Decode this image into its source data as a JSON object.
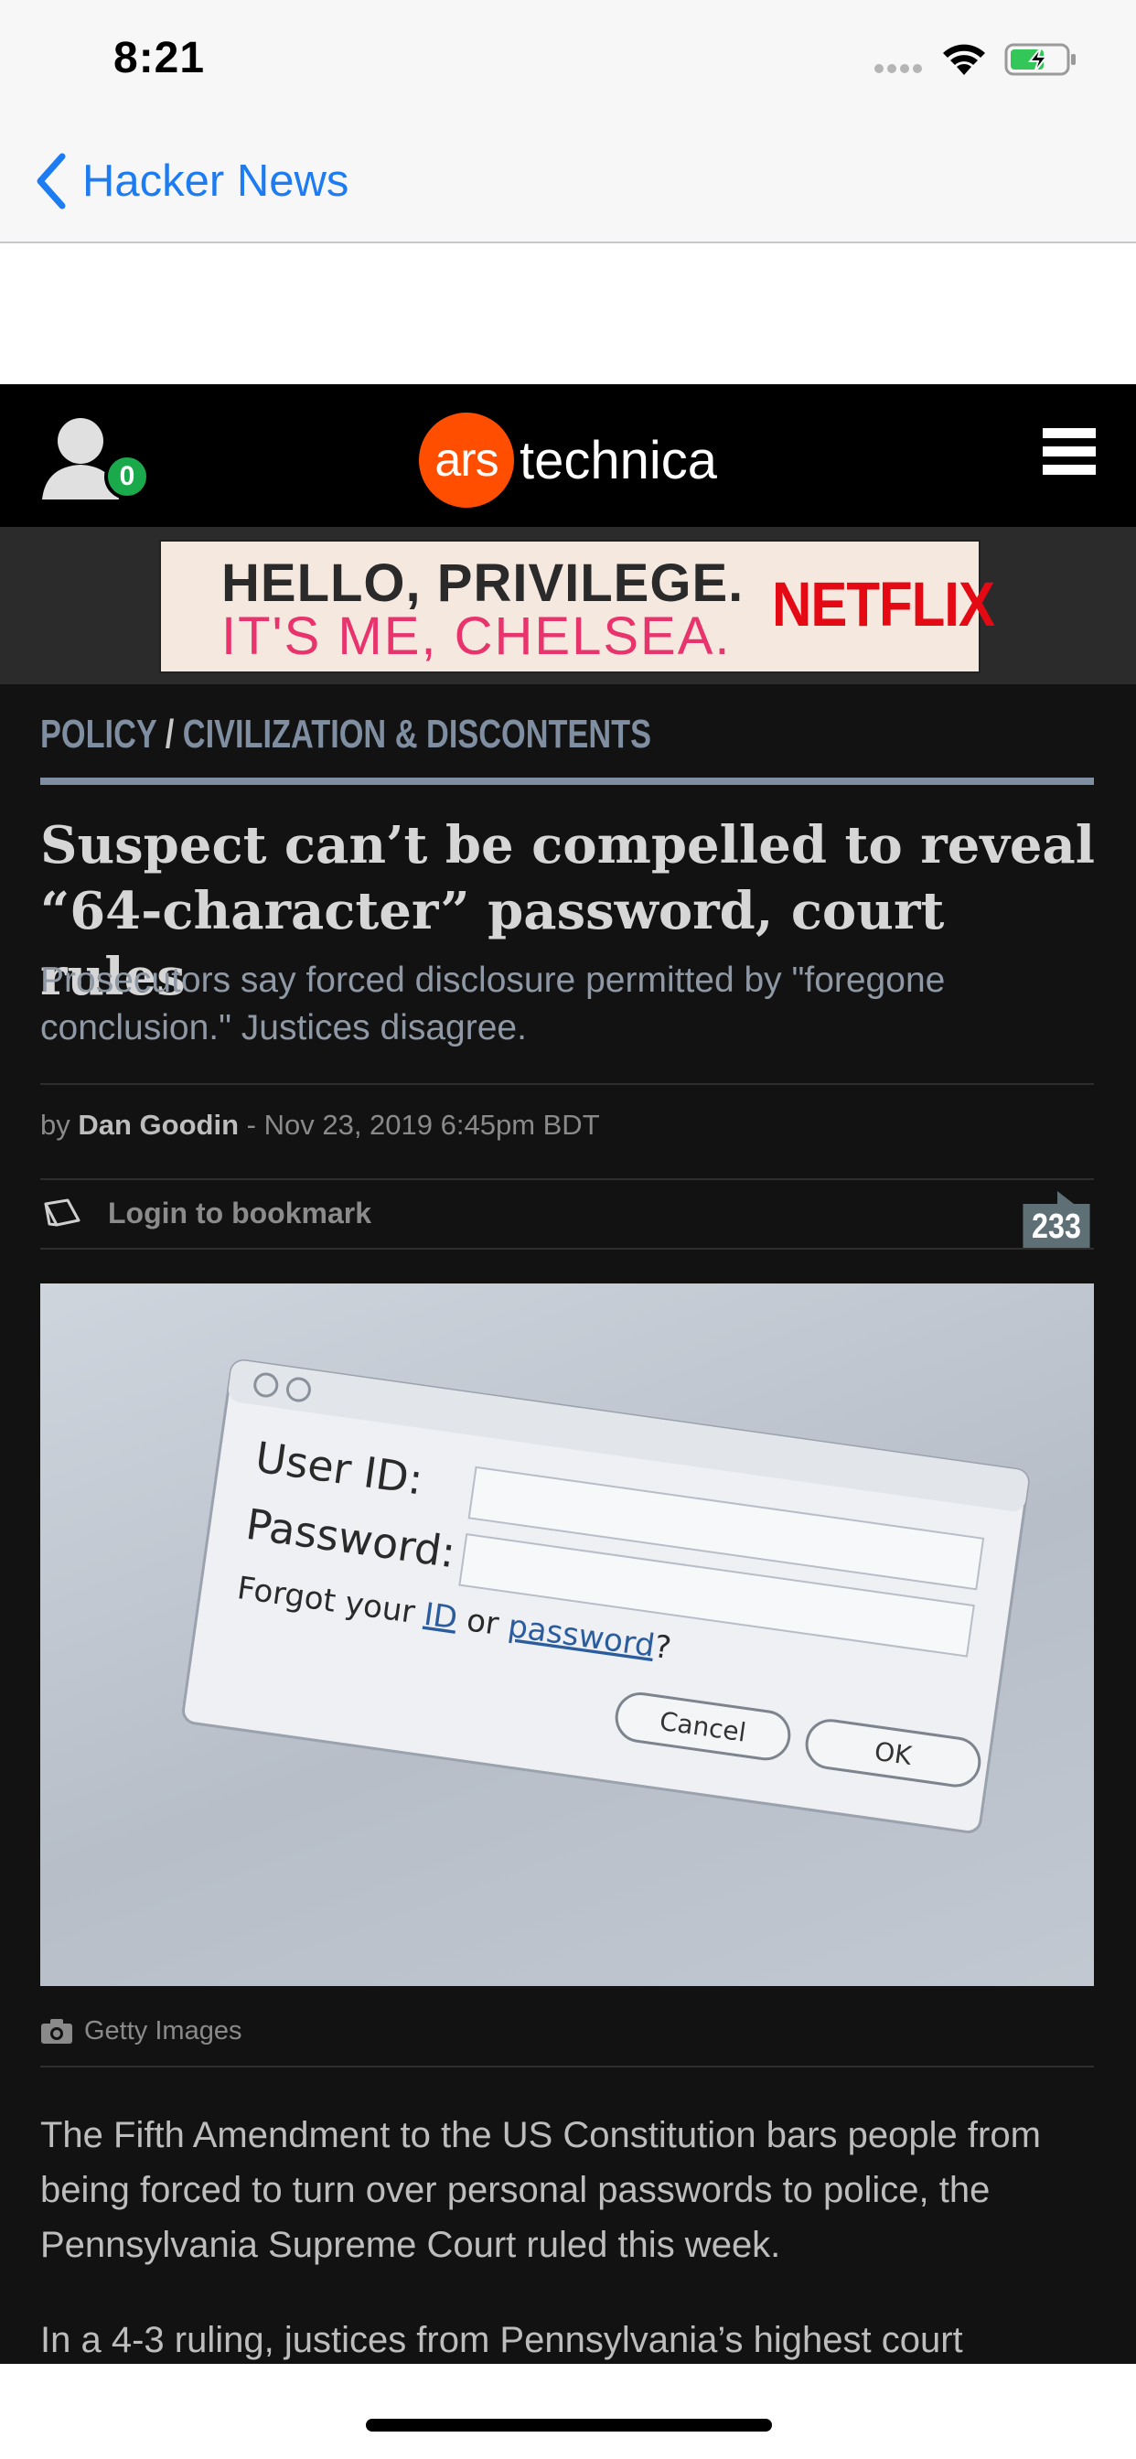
{
  "status_bar": {
    "time": "8:21"
  },
  "nav": {
    "back_label": "Hacker News"
  },
  "ars": {
    "notification_count": "0",
    "logo_circle": "ars",
    "logo_word": "technica"
  },
  "ad": {
    "line1": "HELLO, PRIVILEGE.",
    "line2": "IT'S ME, CHELSEA.",
    "brand": "NETFLIX"
  },
  "article": {
    "breadcrumb": [
      "POLICY",
      "/",
      "CIVILIZATION & DISCONTENTS"
    ],
    "headline": "Suspect can’t be compelled to reveal “64-character” password, court rules",
    "dek": "Prosecutors say forced disclosure permitted by \"foregone conclusion.\" Justices disagree.",
    "byline_prefix": "by",
    "author": "Dan Goodin",
    "date": "- Nov 23, 2019 6:45pm BDT",
    "bookmark_label": "Login to bookmark",
    "comment_count": "233",
    "hero_image": {
      "user_id_label": "User ID:",
      "password_label": "Password:",
      "forgot_prefix": "Forgot your",
      "forgot_id": "ID",
      "forgot_or": "or",
      "forgot_password": "password",
      "forgot_suffix": "?",
      "cancel_label": "Cancel",
      "ok_label": "OK"
    },
    "image_credit": "Getty Images",
    "paragraphs": [
      "The Fifth Amendment to the US Constitution bars people from being forced to turn over personal passwords to police, the Pennsylvania Supreme Court ruled this week.",
      "In a 4-3 ruling, justices from Pennsylvania’s highest court"
    ]
  },
  "colors": {
    "ars_orange": "#ff4e00",
    "ios_blue": "#1e7cf2",
    "netflix_red": "#e50914",
    "badge_green": "#1aa94b",
    "battery_green": "#33c759"
  },
  "icons": [
    "chevron-left-icon",
    "user-icon",
    "hamburger-menu-icon",
    "bookmark-icon",
    "comment-bubble-icon",
    "camera-icon",
    "wifi-icon",
    "battery-charging-icon",
    "signal-icon"
  ]
}
